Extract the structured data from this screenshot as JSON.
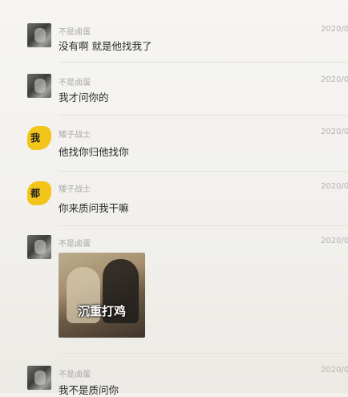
{
  "messages": [
    {
      "sender": "不是卤蛋",
      "time": "2020/0",
      "text": "没有啊 就是他找我了"
    },
    {
      "sender": "不是卤蛋",
      "time": "2020/0",
      "text": "我才问你的"
    },
    {
      "sender": "矮子战士",
      "time": "2020/0",
      "text": "他找你归他找你",
      "avatar_text": "我"
    },
    {
      "sender": "矮子战士",
      "time": "2020/0",
      "text": "你来质问我干嘛",
      "avatar_text": "都"
    },
    {
      "sender": "不是卤蛋",
      "time": "2020/0",
      "sticker_caption": "沉重打鸡"
    },
    {
      "sender": "不是卤蛋",
      "time": "2020/0",
      "text": "我不是质问你"
    }
  ]
}
